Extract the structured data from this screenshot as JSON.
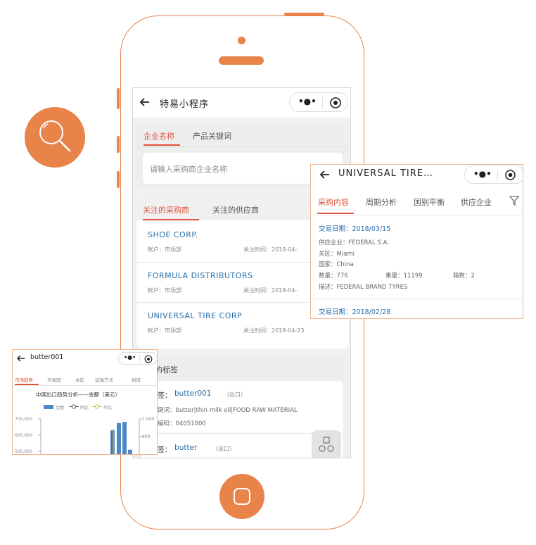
{
  "main": {
    "nav_title": "特易小程序",
    "search_tabs": [
      "企业名称",
      "产品关键词"
    ],
    "search_placeholder": "请输入采购商企业名称",
    "follow_tabs": [
      "关注的采购商",
      "关注的供应商"
    ],
    "companies": [
      {
        "name": "SHOE CORP.",
        "account": "帐户：市场部",
        "time": "关注时间：2018-04-"
      },
      {
        "name": "FORMULA DISTRIBUTORS",
        "account": "帐户：市场部",
        "time": "关注时间：2018-04-"
      },
      {
        "name": "UNIVERSAL TIRE CORP",
        "account": "帐户：市场部",
        "time": "关注时间：2018-04-23"
      }
    ],
    "tags_title": "的标签",
    "tags": [
      {
        "label": "签：",
        "value": "butter001",
        "type": "（出口）",
        "keyword": "键词：butter|thin milk oil|FOOD RAW MATERIAL",
        "code": "编码：04051000"
      },
      {
        "label": "签：",
        "value": "butter",
        "type": "（出口）"
      }
    ]
  },
  "detail_popup": {
    "title": "UNIVERSAL TIRE…",
    "tabs": [
      "采购内容",
      "周期分析",
      "国别平衡",
      "供应企业"
    ],
    "records": [
      {
        "date_label": "交易日期：2018/03/15",
        "supplier": "供应企业：FEDERAL S.A.",
        "port": "关区：Miami",
        "country": "国家：China",
        "quantity": "数量：776",
        "weight": "重量：11199",
        "boxes": "箱数：2",
        "desc": "描述：FEDERAL BRAND TYRES"
      },
      {
        "date_label": "交易日期：2018/02/28"
      }
    ]
  },
  "chart_popup": {
    "title": "butter001",
    "tabs": [
      "市场趋势",
      "贸易国",
      "关区",
      "运输方式",
      "构成"
    ],
    "chart_data": {
      "type": "bar",
      "title": "中国出口趋势分析——金额（美元）",
      "legend": [
        "金额",
        "同比",
        "环比"
      ],
      "left_ticks": [
        "700,000",
        "600,000",
        "500,000"
      ],
      "right_ticks": [
        "1,000",
        "800"
      ],
      "ylim": [
        500000,
        700000
      ],
      "values": [
        630000,
        675000,
        682000,
        510000
      ],
      "line_series": [
        {
          "name": "同比",
          "values": [
            620000
          ]
        },
        {
          "name": "环比",
          "values": [
            640000
          ]
        }
      ]
    }
  },
  "colors": {
    "accent": "#e8834a",
    "tab_active": "#e0533d",
    "link": "#2a6fa8",
    "bar": "#4f87c7"
  }
}
